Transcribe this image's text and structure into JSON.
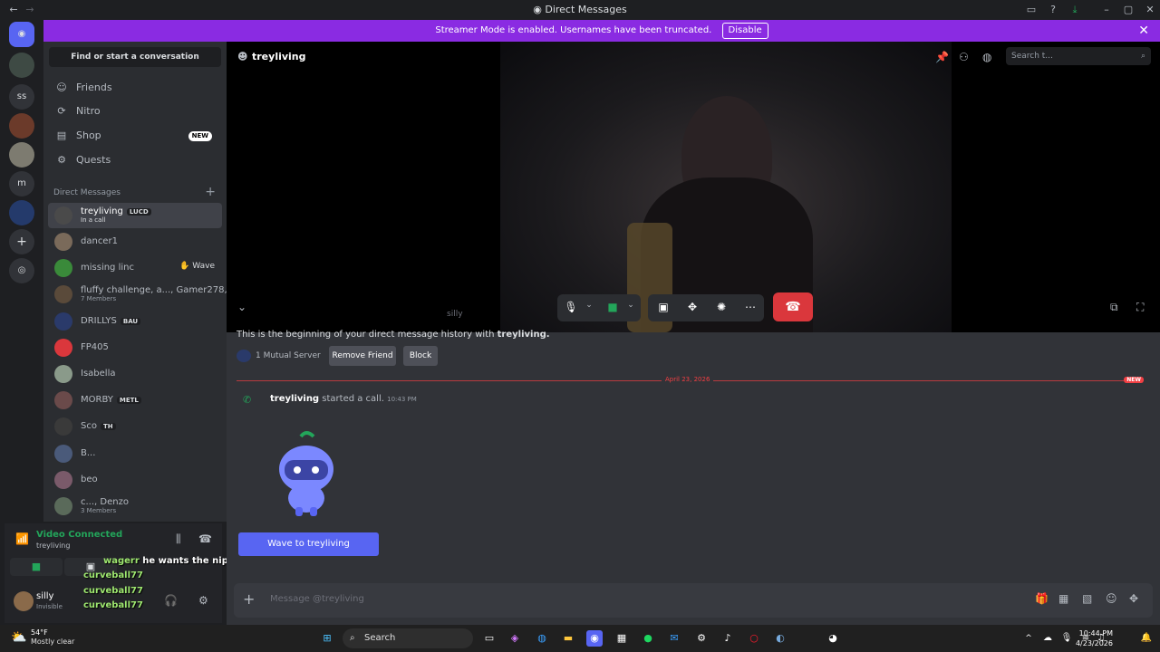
{
  "window": {
    "title": "Direct Messages"
  },
  "banner": {
    "text": "Streamer Mode is enabled. Usernames have been truncated.",
    "button": "Disable",
    "color": "#8a2be2"
  },
  "servers": [
    "ss",
    "m"
  ],
  "sidebar": {
    "find": "Find or start a conversation",
    "nav": [
      {
        "label": "Friends",
        "icon": "friends-icon"
      },
      {
        "label": "Nitro",
        "icon": "nitro-icon"
      },
      {
        "label": "Shop",
        "icon": "shop-icon",
        "badge": "NEW"
      },
      {
        "label": "Quests",
        "icon": "quests-icon"
      }
    ],
    "dm_header": "Direct Messages",
    "dms": [
      {
        "name": "treyliving",
        "tag": "LUCD",
        "sub": "In a call"
      },
      {
        "name": "dancer1"
      },
      {
        "name": "missing linc",
        "action": "Wave"
      },
      {
        "name": "fluffy challenge, a..., Gamer278,...",
        "sub": "7 Members"
      },
      {
        "name": "DRILLYS",
        "tag": "BAU"
      },
      {
        "name": "FP405"
      },
      {
        "name": "Isabella"
      },
      {
        "name": "MORBY",
        "tag": "METL"
      },
      {
        "name": "Sco",
        "tag": "TH"
      },
      {
        "name": "B..."
      },
      {
        "name": "beo"
      },
      {
        "name": "c..., Denzo",
        "sub": "3 Members"
      }
    ]
  },
  "voice": {
    "status": "Video Connected",
    "channel": "treyliving"
  },
  "user": {
    "name": "silly",
    "status": "Invisible"
  },
  "overlay": {
    "lines": [
      {
        "user": "wagerr",
        "text": "he wants the nip slip only...."
      },
      {
        "user": "curveball77",
        "text": ""
      },
      {
        "user": "curveball77",
        "text": ""
      },
      {
        "user": "curveball77",
        "text": ""
      }
    ]
  },
  "main": {
    "header_name": "treyliving",
    "search_placeholder": "Search t...",
    "video_caption": "silly",
    "beginning": "This is the beginning of your direct message history with ",
    "beginning_name": "treyliving.",
    "mutual": "1 Mutual Server",
    "remove_friend": "Remove Friend",
    "block": "Block",
    "divider_date": "April 23, 2026",
    "new_tag": "NEW",
    "call_user": "treyliving",
    "call_text": " started a call.",
    "call_time": "10:43 PM",
    "wave_button": "Wave to treyliving",
    "composer_placeholder": "Message @treyliving"
  },
  "taskbar": {
    "weather_temp": "54°F",
    "weather_desc": "Mostly clear",
    "search": "Search",
    "time": "10:44 PM",
    "date": "4/23/2026"
  }
}
